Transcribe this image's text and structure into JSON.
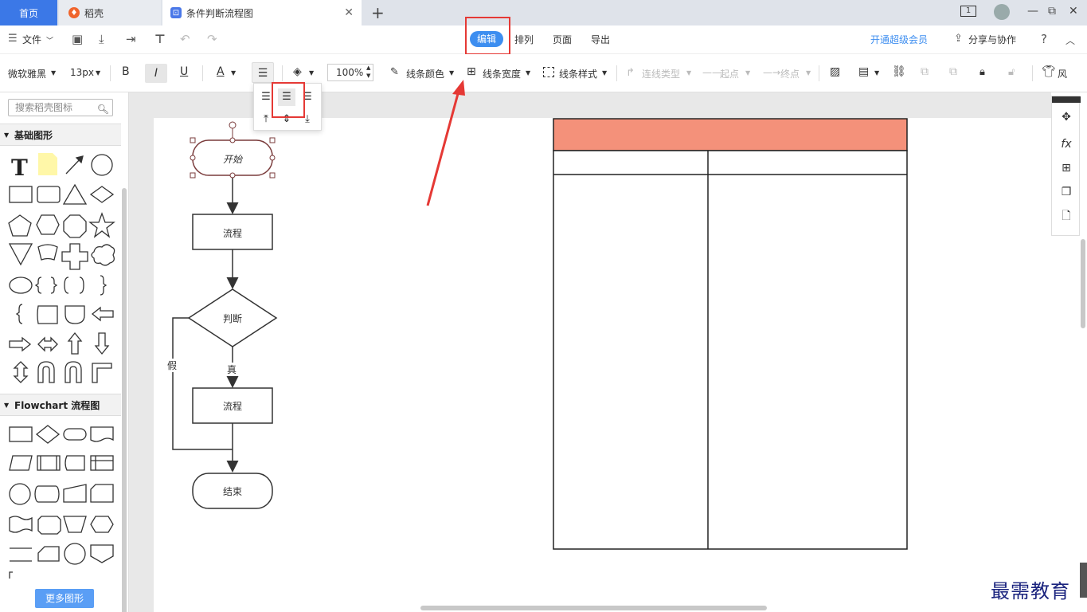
{
  "tabs": {
    "home": "首页",
    "daoke": "稻壳",
    "active": "条件判断流程图"
  },
  "window": {
    "page_count": "1"
  },
  "menubar": {
    "file": "文件",
    "tabs": [
      "编辑",
      "排列",
      "页面",
      "导出"
    ],
    "vip": "开通超级会员",
    "share": "分享与协作",
    "help": "?"
  },
  "format": {
    "font": "微软雅黑",
    "size": "13px",
    "bold": "B",
    "italic": "I",
    "underline": "U",
    "color": "A",
    "zoom": "100%",
    "line_color": "线条颜色",
    "line_width": "线条宽度",
    "line_style": "线条样式",
    "connector": "连线类型",
    "start": "起点",
    "end": "终点",
    "wind": "风"
  },
  "leftpanel": {
    "search_placeholder": "搜索稻壳图标",
    "section_basic": "基础图形",
    "section_flow": "Flowchart 流程图",
    "more": "更多图形"
  },
  "flow": {
    "start": "开始",
    "process1": "流程",
    "decision": "判断",
    "no": "假",
    "yes": "真",
    "process2": "流程",
    "end": "结束"
  },
  "colors": {
    "table_header": "#f4917a",
    "accent": "#3d8ef0",
    "highlight": "#e53935"
  },
  "watermark": "最需教育"
}
